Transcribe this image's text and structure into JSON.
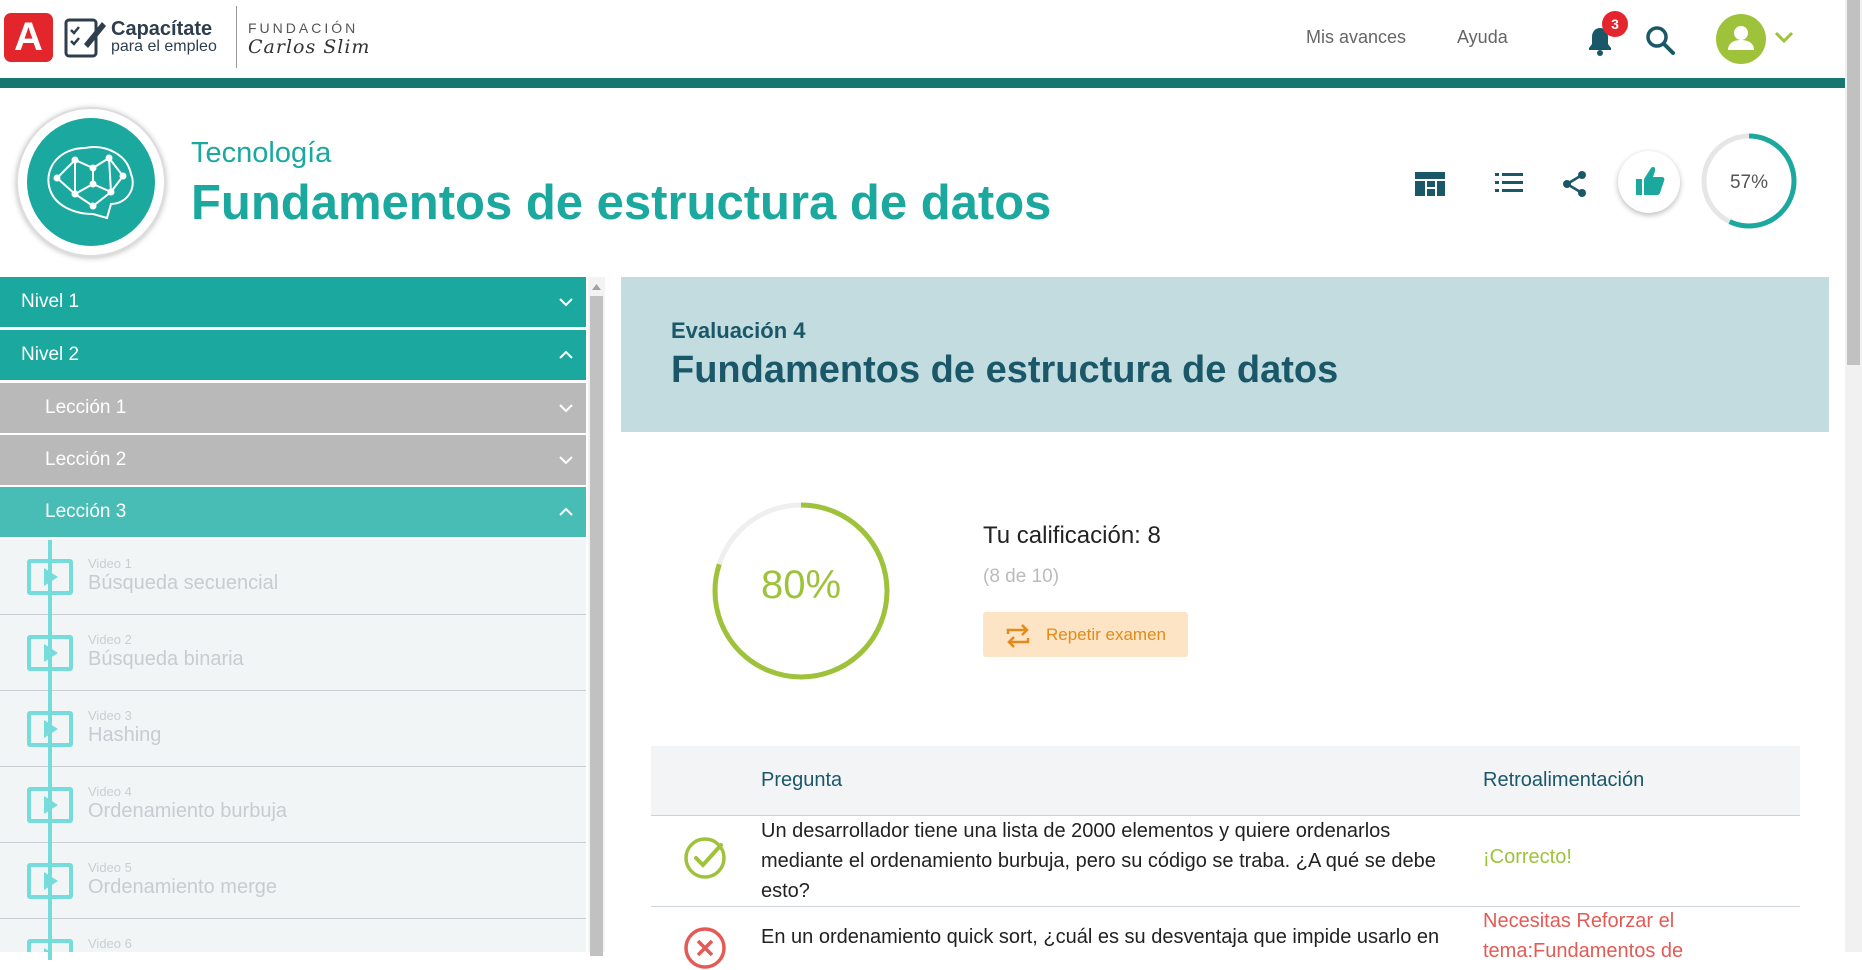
{
  "header": {
    "logo_letter": "A",
    "brand_title": "Capacítate",
    "brand_subtitle": "para el empleo",
    "foundation_line1": "FUNDACIÓN",
    "foundation_line2": "Carlos Slim",
    "nav": {
      "progress_label": "Mis avances",
      "help_label": "Ayuda"
    },
    "notifications_count": "3"
  },
  "course": {
    "category": "Tecnología",
    "title": "Fundamentos de estructura de datos",
    "progress_text": "57%",
    "progress_value": 57,
    "accent_color": "#1ba89f"
  },
  "sidebar": {
    "levels": [
      {
        "label": "Nivel 1",
        "expanded": false
      },
      {
        "label": "Nivel 2",
        "expanded": true
      }
    ],
    "lessons": [
      {
        "label": "Lección 1",
        "expanded": false
      },
      {
        "label": "Lección 2",
        "expanded": false
      },
      {
        "label": "Lección 3",
        "expanded": true
      }
    ],
    "videos": [
      {
        "number": "Video 1",
        "title": "Búsqueda secuencial"
      },
      {
        "number": "Video 2",
        "title": "Búsqueda binaria"
      },
      {
        "number": "Video 3",
        "title": "Hashing"
      },
      {
        "number": "Video 4",
        "title": "Ordenamiento burbuja"
      },
      {
        "number": "Video 5",
        "title": "Ordenamiento merge"
      },
      {
        "number": "Video 6",
        "title": ""
      }
    ]
  },
  "evaluation": {
    "label": "Evaluación 4",
    "title": "Fundamentos de estructura de datos",
    "score_text": "80%",
    "score_value": 80,
    "grade_label": "Tu calificación: 8",
    "grade_detail": "(8 de 10)",
    "retry_label": "Repetir examen"
  },
  "results_table": {
    "headers": {
      "question": "Pregunta",
      "feedback": "Retroalimentación"
    },
    "rows": [
      {
        "status": "correct",
        "question": "Un desarrollador tiene una lista de 2000 elementos y quiere ordenarlos mediante el ordenamiento burbuja, pero su código se traba. ¿A qué se debe esto?",
        "feedback": "¡Correcto!"
      },
      {
        "status": "incorrect",
        "question": "En un ordenamiento quick sort, ¿cuál es su desventaja que impide usarlo en",
        "feedback": "Necesitas Reforzar el tema:Fundamentos de"
      }
    ]
  },
  "colors": {
    "teal": "#1ba89f",
    "dark_teal": "#15776f",
    "lime": "#9ec33b",
    "red": "#e45a55",
    "orange": "#e38a1a"
  }
}
